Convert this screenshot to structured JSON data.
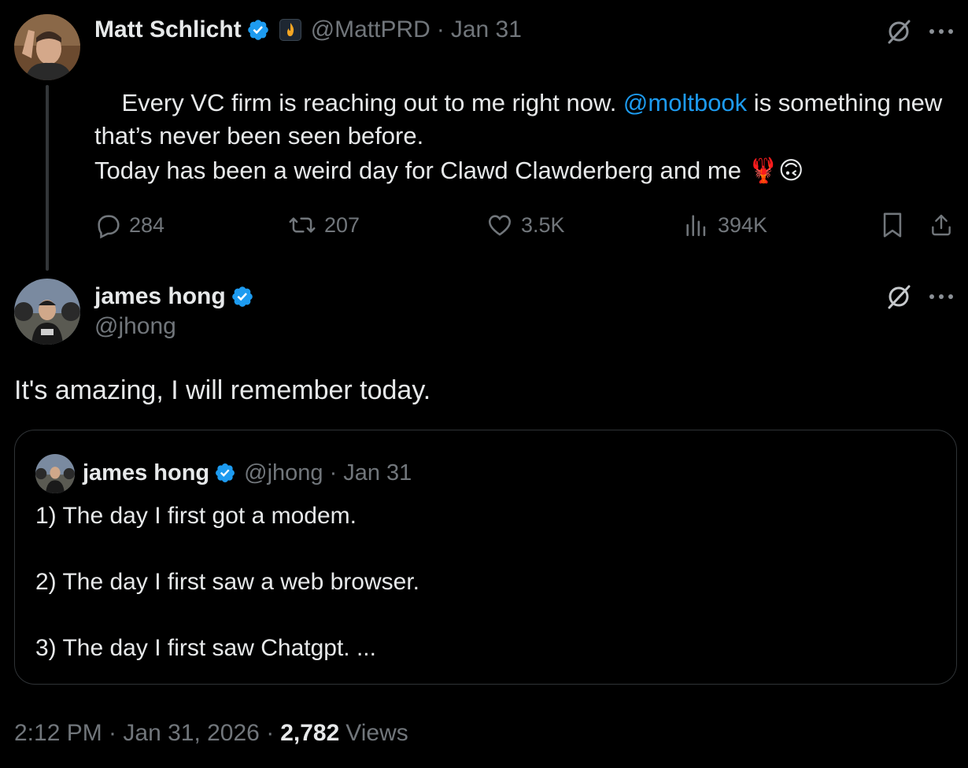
{
  "parent_tweet": {
    "author_name": "Matt Schlicht",
    "handle": "@MattPRD",
    "separator": "·",
    "date": "Jan 31",
    "text_before_mention": "Every VC firm is reaching out to me right now. ",
    "mention": "@moltbook",
    "text_after_mention": " is something new that’s never been seen before.",
    "text_line2": "Today has been a weird day for Clawd Clawderberg and me 🦞🙃",
    "replies": "284",
    "reposts": "207",
    "likes": "3.5K",
    "views": "394K"
  },
  "main_tweet": {
    "author_name": "james hong",
    "handle": "@jhong",
    "text": "It's amazing, I will remember today.",
    "timestamp": "2:12 PM · Jan 31, 2026 ·",
    "views_count": "2,782",
    "views_label": "Views"
  },
  "quoted_tweet": {
    "author_name": "james hong",
    "handle": "@jhong",
    "separator": "·",
    "date": "Jan 31",
    "lines": [
      "1) The day I first got a modem.",
      "2) The day I first saw a web browser.",
      "3) The day I first saw Chatgpt. ..."
    ]
  },
  "icons": {
    "verified": "verified-badge-icon",
    "grok": "grok-icon",
    "more": "more-icon",
    "reply": "reply-icon",
    "repost": "repost-icon",
    "like": "like-icon",
    "views": "views-icon",
    "bookmark": "bookmark-icon",
    "share": "share-icon"
  },
  "colors": {
    "background": "#000000",
    "text": "#e7e9ea",
    "muted": "#71767b",
    "link": "#1d9bf0",
    "verified": "#1d9bf0",
    "border": "#2f3336"
  }
}
